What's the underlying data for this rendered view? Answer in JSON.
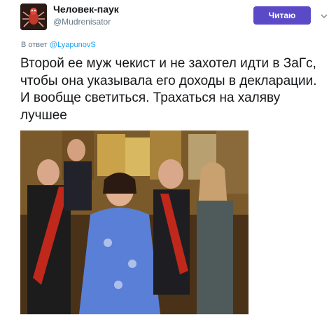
{
  "account": {
    "display_name": "Человек-паук",
    "handle": "@Mudrenisator",
    "avatar_icon": "spider-avatar-icon"
  },
  "actions": {
    "follow_label": "Читаю",
    "menu_icon": "chevron-down-icon"
  },
  "reply": {
    "prefix": "В ответ",
    "mention": "@LyapunovS"
  },
  "tweet": {
    "text": "Второй ее муж чекист и не захотел идти в ЗаГс, чтобы она указывала его доходы в декларации. И вообще светиться. Трахаться на халяву лучшее"
  },
  "colors": {
    "accent": "#5b4ac8",
    "link": "#1da1f2",
    "muted": "#657786"
  }
}
